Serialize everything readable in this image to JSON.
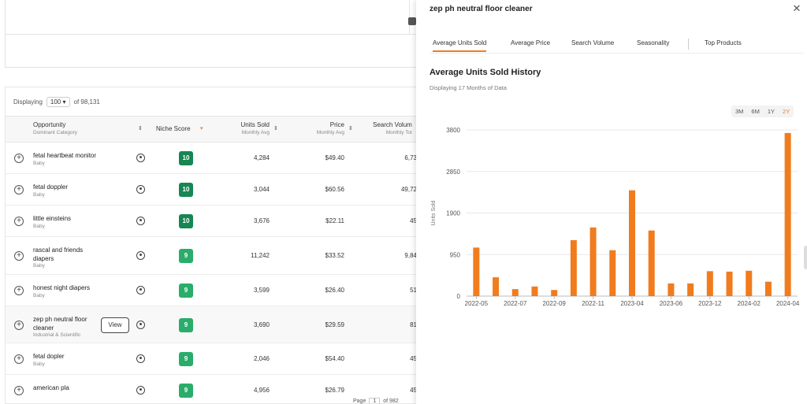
{
  "table": {
    "displaying_label": "Displaying",
    "per_page": "100",
    "total_label": "of 98,131",
    "headers": {
      "opportunity": "Opportunity",
      "opportunity_sub": "Dominant Category",
      "niche_score": "Niche Score",
      "units_sold": "Units Sold",
      "units_sold_sub": "Monthly Avg",
      "price": "Price",
      "price_sub": "Monthly Avg",
      "search_volume": "Search Volum",
      "search_volume_sub": "Monthly Tot"
    },
    "rows": [
      {
        "name1": "fetal heartbeat monitor",
        "name2": "",
        "category": "Baby",
        "score": "10",
        "units": "4,284",
        "price": "$49.40",
        "search": "6,73"
      },
      {
        "name1": "fetal doppler",
        "name2": "",
        "category": "Baby",
        "score": "10",
        "units": "3,044",
        "price": "$60.56",
        "search": "49,72"
      },
      {
        "name1": "little einsteins",
        "name2": "",
        "category": "Baby",
        "score": "10",
        "units": "3,676",
        "price": "$22.11",
        "search": "45"
      },
      {
        "name1": "rascal and friends",
        "name2": "diapers",
        "category": "Baby",
        "score": "9",
        "units": "11,242",
        "price": "$33.52",
        "search": "9,84"
      },
      {
        "name1": "honest night diapers",
        "name2": "",
        "category": "Baby",
        "score": "9",
        "units": "3,599",
        "price": "$26.40",
        "search": "51"
      },
      {
        "name1": "zep ph neutral floor",
        "name2": "cleaner",
        "category": "Industrial & Scientific",
        "score": "9",
        "units": "3,690",
        "price": "$29.59",
        "search": "81"
      },
      {
        "name1": "fetal dopler",
        "name2": "",
        "category": "Baby",
        "score": "9",
        "units": "2,046",
        "price": "$54.40",
        "search": "45"
      },
      {
        "name1": "american pla",
        "name2": "",
        "category": "",
        "score": "9",
        "units": "4,956",
        "price": "$26.79",
        "search": "45"
      }
    ],
    "view_button": "View",
    "pager": {
      "page_label": "Page",
      "page": "1",
      "of_label": "of 982"
    }
  },
  "panel": {
    "title": "zep ph neutral floor cleaner",
    "tabs": [
      "Average Units Sold",
      "Average Price",
      "Search Volume",
      "Seasonality",
      "Top Products"
    ],
    "chart_title": "Average Units Sold History",
    "chart_subtitle": "Displaying 17 Months of Data",
    "ranges": [
      "3M",
      "6M",
      "1Y",
      "2Y"
    ],
    "active_range": "2Y"
  },
  "colors": {
    "accent": "#f07c1e",
    "bar": "#f07c1e",
    "score_high": "#168653",
    "score_mid": "#2aad6a"
  },
  "chart_data": {
    "type": "bar",
    "ylabel": "Units Sold",
    "yticks": [
      0,
      950,
      1900,
      2850,
      3800
    ],
    "ylim": [
      0,
      3800
    ],
    "xticks": [
      "2022-05",
      "2022-07",
      "2022-09",
      "2022-11",
      "2023-04",
      "2023-06",
      "2023-12",
      "2024-02",
      "2024-04"
    ],
    "categories": [
      "2022-05",
      "2022-06",
      "2022-07",
      "2022-08",
      "2022-09",
      "2022-10",
      "2022-11",
      "2023-01",
      "2023-04",
      "2023-05",
      "2023-06",
      "2023-11",
      "2023-12",
      "2024-01",
      "2024-02",
      "2024-03",
      "2024-04"
    ],
    "values": [
      1110,
      430,
      160,
      220,
      140,
      1280,
      1570,
      1050,
      2420,
      1500,
      290,
      290,
      570,
      560,
      580,
      330,
      3730
    ],
    "grid": true
  }
}
